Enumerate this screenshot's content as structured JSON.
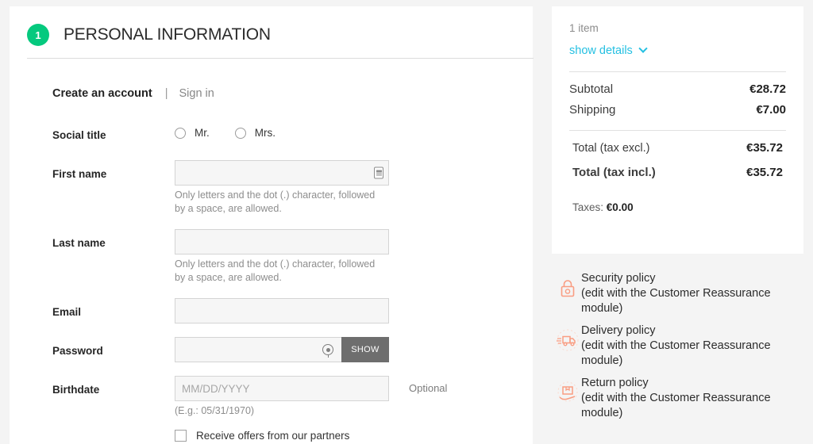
{
  "step": {
    "number": "1",
    "title": "PERSONAL INFORMATION",
    "badge_color": "#05c97e"
  },
  "account_tabs": {
    "create_label": "Create an account",
    "separator": "|",
    "signin_label": "Sign in"
  },
  "form": {
    "social_title": {
      "label": "Social title",
      "options": [
        {
          "label": "Mr.",
          "selected": false
        },
        {
          "label": "Mrs.",
          "selected": false
        }
      ]
    },
    "first_name": {
      "label": "First name",
      "value": "",
      "placeholder": "",
      "hint": "Only letters and the dot (.) character, followed by a space, are allowed.",
      "icon": "contact-card-icon"
    },
    "last_name": {
      "label": "Last name",
      "value": "",
      "placeholder": "",
      "hint": "Only letters and the dot (.) character, followed by a space, are allowed."
    },
    "email": {
      "label": "Email",
      "value": "",
      "placeholder": ""
    },
    "password": {
      "label": "Password",
      "value": "",
      "placeholder": "",
      "show_button_label": "SHOW",
      "show_button_color": "#6e6e6e"
    },
    "birthdate": {
      "label": "Birthdate",
      "value": "",
      "placeholder": "MM/DD/YYYY",
      "hint": "(E.g.: 05/31/1970)",
      "optional_tag": "Optional"
    },
    "offers_checkbox": {
      "label": "Receive offers from our partners",
      "checked": false
    }
  },
  "summary": {
    "items_count": "1 item",
    "show_details_label": "show details",
    "link_color": "#25c0e2",
    "rows": [
      {
        "label": "Subtotal",
        "value": "€28.72"
      },
      {
        "label": "Shipping",
        "value": "€7.00"
      }
    ],
    "total_excl": {
      "label": "Total (tax excl.)",
      "value": "€35.72"
    },
    "total_incl": {
      "label": "Total (tax incl.)",
      "value": "€35.72"
    },
    "taxes": {
      "label": "Taxes:",
      "value": "€0.00"
    }
  },
  "reassurance": {
    "icon_color": "#f99d82",
    "items": [
      {
        "title": "Security policy",
        "note": "(edit with the Customer Reassurance module)",
        "icon": "padlock-icon"
      },
      {
        "title": "Delivery policy",
        "note": "(edit with the Customer Reassurance module)",
        "icon": "delivery-truck-icon"
      },
      {
        "title": "Return policy",
        "note": "(edit with the Customer Reassurance module)",
        "icon": "return-box-icon"
      }
    ]
  }
}
